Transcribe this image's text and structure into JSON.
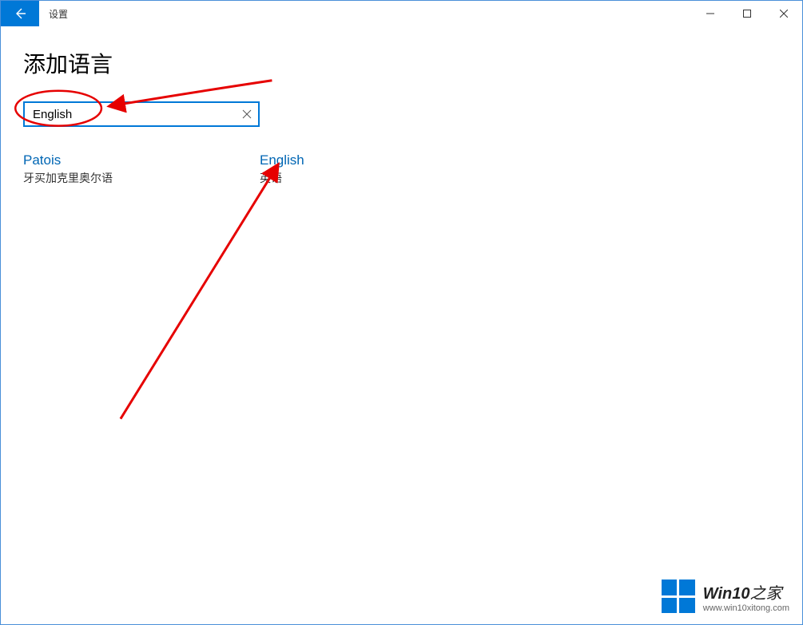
{
  "window": {
    "title": "设置"
  },
  "page": {
    "heading": "添加语言"
  },
  "search": {
    "value": "English"
  },
  "results": [
    {
      "name": "Patois",
      "desc": "牙买加克里奥尔语"
    },
    {
      "name": "English",
      "desc": "英语"
    }
  ],
  "watermark": {
    "brand_main": "Win10",
    "brand_sub": "之家",
    "url": "www.win10xitong.com"
  }
}
